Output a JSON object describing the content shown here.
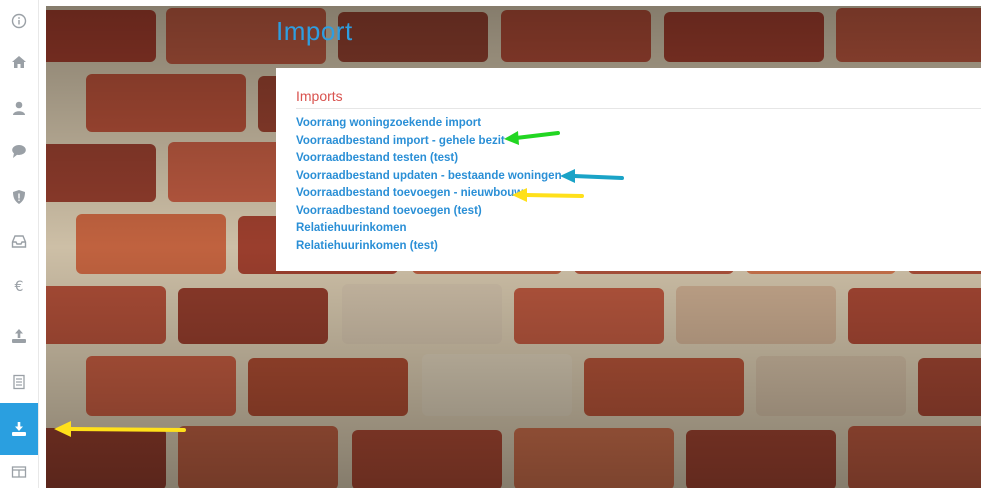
{
  "sidebar": {
    "items": [
      {
        "icon": "info-icon"
      },
      {
        "icon": "home-icon"
      },
      {
        "icon": "user-icon"
      },
      {
        "icon": "chat-icon"
      },
      {
        "icon": "shield-icon"
      },
      {
        "icon": "inbox-icon"
      },
      {
        "icon": "euro-icon"
      },
      {
        "icon": "upload-icon"
      },
      {
        "icon": "document-icon"
      },
      {
        "icon": "download-icon",
        "active": true
      },
      {
        "icon": "window-icon"
      }
    ],
    "active_color": "#2a9fe0"
  },
  "page": {
    "title": "Import"
  },
  "imports": {
    "header": "Imports",
    "links": [
      "Voorrang woningzoekende import",
      "Voorraadbestand import - gehele bezit",
      "Voorraadbestand testen (test)",
      "Voorraadbestand updaten - bestaande woningen",
      "Voorraadbestand toevoegen - nieuwbouw",
      "Voorraadbestand toevoegen (test)",
      "Relatiehuurinkomen",
      "Relatiehuurinkomen  (test)"
    ]
  },
  "colors": {
    "link": "#2a8fd6",
    "header": "#d9534f",
    "title": "#2e9ee0",
    "arrow_green": "#22d622",
    "arrow_blue": "#1aa3c7",
    "arrow_yellow": "#ffe01a"
  }
}
